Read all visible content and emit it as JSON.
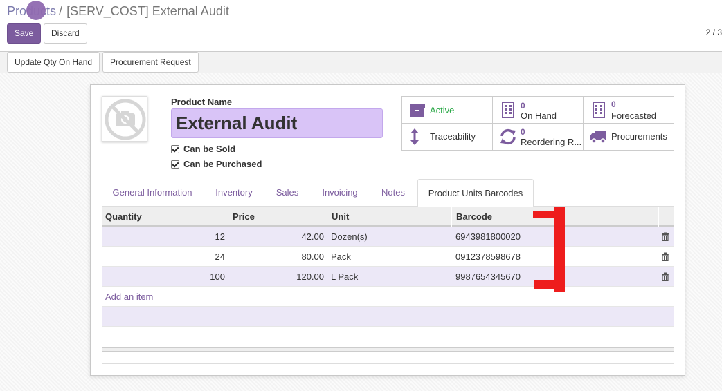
{
  "breadcrumb": {
    "parent": "Products",
    "separator": "/",
    "current": "[SERV_COST] External Audit"
  },
  "toolbar": {
    "save_label": "Save",
    "discard_label": "Discard",
    "pager": "2 / 3"
  },
  "statusbar": {
    "update_qty_label": "Update Qty On Hand",
    "procurement_request_label": "Procurement Request"
  },
  "product": {
    "name_label": "Product Name",
    "name_value": "External Audit",
    "can_be_sold_label": "Can be Sold",
    "can_be_sold": true,
    "can_be_purchased_label": "Can be Purchased",
    "can_be_purchased": true
  },
  "smart_buttons": {
    "active": {
      "label": "Active",
      "icon": "archive-icon",
      "color": "#28a745"
    },
    "on_hand": {
      "value": "0",
      "label": "On Hand",
      "icon": "building-icon"
    },
    "forecasted": {
      "value": "0",
      "label": "Forecasted",
      "icon": "building-icon"
    },
    "traceability": {
      "label": "Traceability",
      "icon": "arrows-vertical-icon"
    },
    "reordering": {
      "value": "0",
      "label": "Reordering R...",
      "icon": "refresh-icon"
    },
    "procurements": {
      "label": "Procurements",
      "icon": "truck-icon"
    }
  },
  "tabs": [
    {
      "label": "General Information"
    },
    {
      "label": "Inventory"
    },
    {
      "label": "Sales"
    },
    {
      "label": "Invoicing"
    },
    {
      "label": "Notes"
    },
    {
      "label": "Product Units Barcodes",
      "active": true
    }
  ],
  "table": {
    "headers": {
      "quantity": "Quantity",
      "price": "Price",
      "unit": "Unit",
      "barcode": "Barcode"
    },
    "rows": [
      {
        "quantity": "12",
        "price": "42.00",
        "unit": "Dozen(s)",
        "barcode": "6943981800020"
      },
      {
        "quantity": "24",
        "price": "80.00",
        "unit": "Pack",
        "barcode": "0912378598678"
      },
      {
        "quantity": "100",
        "price": "120.00",
        "unit": "L Pack",
        "barcode": "9987654345670"
      }
    ],
    "add_item_label": "Add an item"
  },
  "colors": {
    "brand": "#7c5c9e",
    "active_green": "#28a745",
    "row_highlight": "#ece8f7",
    "annotation_red": "#ee1d1d"
  }
}
